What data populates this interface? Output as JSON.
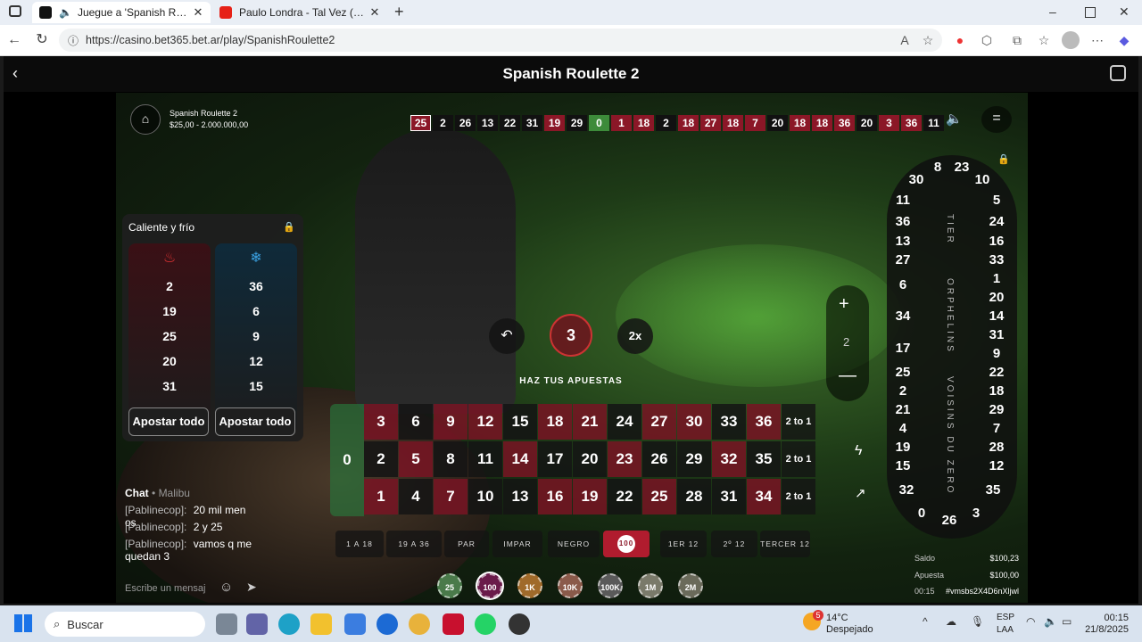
{
  "browser": {
    "tabs": [
      {
        "title": "Juegue a 'Spanish Roulette 2",
        "favicon_color": "#111111"
      },
      {
        "title": "Paulo Londra - Tal Vez (Official Vi",
        "favicon_color": "#e62117"
      }
    ],
    "url": "https://casino.bet365.bet.ar/play/SpanishRoulette2"
  },
  "game": {
    "title": "Spanish Roulette 2",
    "table_name": "Spanish Roulette 2",
    "limits": "$25,00 - 2.000.000,00",
    "history": [
      {
        "n": "25",
        "c": "red"
      },
      {
        "n": "2",
        "c": "black"
      },
      {
        "n": "26",
        "c": "black"
      },
      {
        "n": "13",
        "c": "black"
      },
      {
        "n": "22",
        "c": "black"
      },
      {
        "n": "31",
        "c": "black"
      },
      {
        "n": "19",
        "c": "red"
      },
      {
        "n": "29",
        "c": "black"
      },
      {
        "n": "0",
        "c": "green"
      },
      {
        "n": "1",
        "c": "red"
      },
      {
        "n": "18",
        "c": "red"
      },
      {
        "n": "2",
        "c": "black"
      },
      {
        "n": "18",
        "c": "red"
      },
      {
        "n": "27",
        "c": "red"
      },
      {
        "n": "18",
        "c": "red"
      },
      {
        "n": "7",
        "c": "red"
      },
      {
        "n": "20",
        "c": "black"
      },
      {
        "n": "18",
        "c": "red"
      },
      {
        "n": "18",
        "c": "red"
      },
      {
        "n": "36",
        "c": "red"
      },
      {
        "n": "20",
        "c": "black"
      },
      {
        "n": "3",
        "c": "red"
      },
      {
        "n": "36",
        "c": "red"
      },
      {
        "n": "11",
        "c": "black"
      }
    ],
    "timer": "3",
    "multiplier": "2x",
    "status": "HAZ TUS APUESTAS",
    "zoom_value": "2",
    "hot_cold": {
      "title": "Caliente y frío",
      "hot": [
        "2",
        "19",
        "25",
        "20",
        "31"
      ],
      "cold": [
        "36",
        "6",
        "9",
        "12",
        "15"
      ],
      "bet_all": "Apostar todo"
    },
    "table": {
      "zero": "0",
      "rows": [
        [
          {
            "n": "3",
            "c": "red"
          },
          {
            "n": "6",
            "c": "black"
          },
          {
            "n": "9",
            "c": "red"
          },
          {
            "n": "12",
            "c": "red"
          },
          {
            "n": "15",
            "c": "black"
          },
          {
            "n": "18",
            "c": "red"
          },
          {
            "n": "21",
            "c": "red"
          },
          {
            "n": "24",
            "c": "black"
          },
          {
            "n": "27",
            "c": "red"
          },
          {
            "n": "30",
            "c": "red"
          },
          {
            "n": "33",
            "c": "black"
          },
          {
            "n": "36",
            "c": "red"
          }
        ],
        [
          {
            "n": "2",
            "c": "black"
          },
          {
            "n": "5",
            "c": "red"
          },
          {
            "n": "8",
            "c": "black"
          },
          {
            "n": "11",
            "c": "black"
          },
          {
            "n": "14",
            "c": "red"
          },
          {
            "n": "17",
            "c": "black"
          },
          {
            "n": "20",
            "c": "black"
          },
          {
            "n": "23",
            "c": "red"
          },
          {
            "n": "26",
            "c": "black"
          },
          {
            "n": "29",
            "c": "black"
          },
          {
            "n": "32",
            "c": "red"
          },
          {
            "n": "35",
            "c": "black"
          }
        ],
        [
          {
            "n": "1",
            "c": "red"
          },
          {
            "n": "4",
            "c": "black"
          },
          {
            "n": "7",
            "c": "red"
          },
          {
            "n": "10",
            "c": "black"
          },
          {
            "n": "13",
            "c": "black"
          },
          {
            "n": "16",
            "c": "red"
          },
          {
            "n": "19",
            "c": "red"
          },
          {
            "n": "22",
            "c": "black"
          },
          {
            "n": "25",
            "c": "red"
          },
          {
            "n": "28",
            "c": "black"
          },
          {
            "n": "31",
            "c": "black"
          },
          {
            "n": "34",
            "c": "red"
          }
        ]
      ],
      "column_label": "2 to 1",
      "outside": [
        "1 A 18",
        "19 A 36",
        "PAR",
        "IMPAR",
        "NEGRO",
        "",
        "1ER 12",
        "2º 12",
        "TERCER 12"
      ]
    },
    "racetrack": {
      "sections": [
        "TIER",
        "ORPHELINS",
        "VOISINS DU ZERO"
      ],
      "left": [
        "30",
        "11",
        "36",
        "13",
        "27",
        "6",
        "34",
        "17",
        "25",
        "2",
        "21",
        "4",
        "19",
        "15",
        "32"
      ],
      "right": [
        "10",
        "5",
        "24",
        "16",
        "33",
        "1",
        "20",
        "14",
        "31",
        "9",
        "22",
        "18",
        "29",
        "7",
        "28",
        "12",
        "35"
      ],
      "top": [
        "8",
        "23"
      ],
      "bottom": [
        "0",
        "26",
        "3"
      ]
    },
    "chips": [
      "25",
      "100",
      "1K",
      "10K",
      "100K",
      "1M",
      "2M"
    ],
    "selected_chip": "100",
    "chat": {
      "header": "Chat",
      "room": "Malibu",
      "messages": [
        {
          "user": "[Pablinecop]:",
          "text": "20 mil men os"
        },
        {
          "user": "[Pablinecop]:",
          "text": "2 y 25"
        },
        {
          "user": "[Pablinecop]:",
          "text": "vamos q me quedan 3"
        }
      ],
      "placeholder": "Escribe un mensaj"
    },
    "balance": {
      "label": "Saldo",
      "value": "$100,23"
    },
    "bet": {
      "label": "Apuesta",
      "value": "$100,00"
    },
    "footer": {
      "time": "00:15",
      "round": "#vmsbs2X4D6nXljwl"
    }
  },
  "taskbar": {
    "search_placeholder": "Buscar",
    "weather_temp": "14°C",
    "weather_desc": "Despejado",
    "weather_badge": "5",
    "lang": "ESP",
    "lang2": "LAA",
    "time": "00:15",
    "date": "21/8/2025"
  }
}
